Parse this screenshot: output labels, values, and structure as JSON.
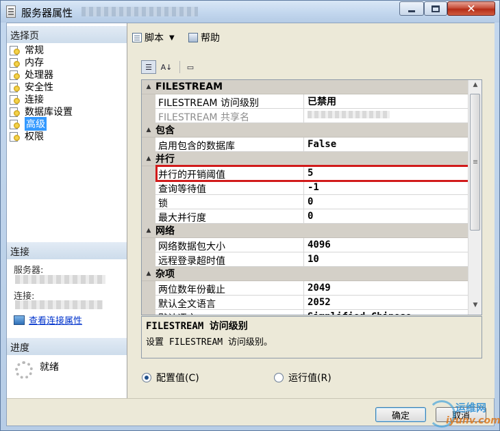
{
  "window": {
    "title": "服务器属性"
  },
  "left_panel": {
    "pages_header": "选择页",
    "pages": [
      {
        "label": "常规",
        "selected": false
      },
      {
        "label": "内存",
        "selected": false
      },
      {
        "label": "处理器",
        "selected": false
      },
      {
        "label": "安全性",
        "selected": false
      },
      {
        "label": "连接",
        "selected": false
      },
      {
        "label": "数据库设置",
        "selected": false
      },
      {
        "label": "高级",
        "selected": true
      },
      {
        "label": "权限",
        "selected": false
      }
    ],
    "connect_header": "连接",
    "server_label": "服务器:",
    "connection_label": "连接:",
    "view_connection_link": "查看连接属性",
    "progress_header": "进度",
    "progress_status": "就绪"
  },
  "toolbar": {
    "script_label": "脚本",
    "help_label": "帮助"
  },
  "grid": {
    "rows": [
      {
        "type": "category",
        "label": "FILESTREAM"
      },
      {
        "type": "property",
        "name": "FILESTREAM 访问级别",
        "value": "已禁用",
        "cn": true
      },
      {
        "type": "property",
        "name": "FILESTREAM 共享名",
        "value": "",
        "disabled": true,
        "blurred": true
      },
      {
        "type": "category",
        "label": "包含"
      },
      {
        "type": "property",
        "name": "启用包含的数据库",
        "value": "False"
      },
      {
        "type": "category",
        "label": "并行"
      },
      {
        "type": "property",
        "name": "并行的开销阈值",
        "value": "5"
      },
      {
        "type": "property",
        "name": "查询等待值",
        "value": "-1"
      },
      {
        "type": "property",
        "name": "锁",
        "value": "0"
      },
      {
        "type": "property",
        "name": "最大并行度",
        "value": "0"
      },
      {
        "type": "category",
        "label": "网络"
      },
      {
        "type": "property",
        "name": "网络数据包大小",
        "value": "4096"
      },
      {
        "type": "property",
        "name": "远程登录超时值",
        "value": "10"
      },
      {
        "type": "category",
        "label": "杂项"
      },
      {
        "type": "property",
        "name": "两位数年份截止",
        "value": "2049"
      },
      {
        "type": "property",
        "name": "默认全文语言",
        "value": "2052"
      },
      {
        "type": "property",
        "name": "默认语言",
        "value": "Simplified Chinese"
      }
    ],
    "highlighted_property": "并行的开销阈值"
  },
  "description": {
    "title": "FILESTREAM 访问级别",
    "text": "设置 FILESTREAM 访问级别。"
  },
  "radios": {
    "config_label": "配置值(C)",
    "running_label": "运行值(R)",
    "selected": "config"
  },
  "buttons": {
    "ok": "确定",
    "cancel": "取消"
  },
  "watermark": {
    "line1": "运维网",
    "line2": "iyunv.com"
  },
  "colors": {
    "highlight_border": "#d11a1a",
    "selection": "#3399ff",
    "link": "#0033cc"
  }
}
